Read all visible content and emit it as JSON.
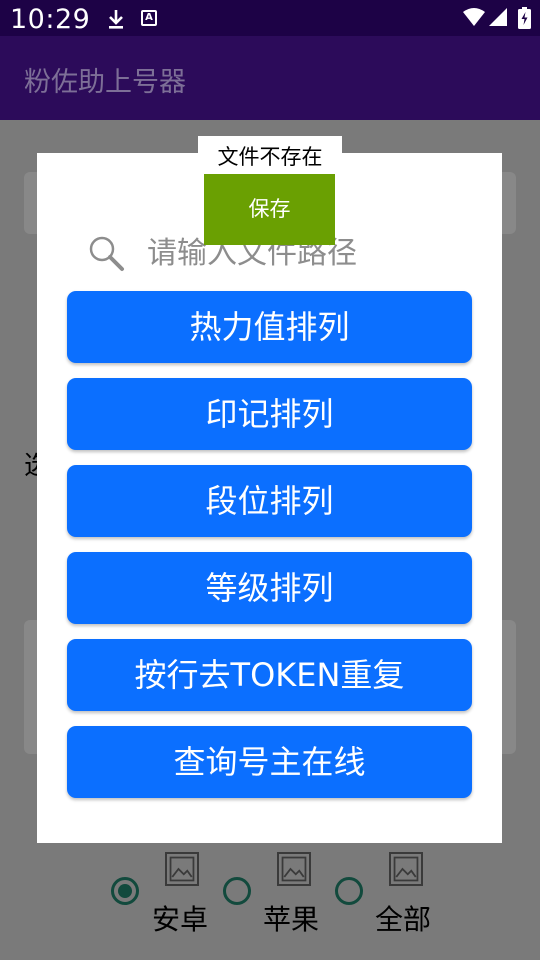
{
  "status_bar": {
    "time": "10:29",
    "download_icon": "download-icon",
    "a_icon_letter": "A",
    "wifi_icon": "wifi-icon",
    "signal_icon": "cell-signal-icon",
    "battery_icon": "battery-charging-icon"
  },
  "app_bar": {
    "title": "粉佐助上号器"
  },
  "background": {
    "partial_text": "选"
  },
  "dialog": {
    "search": {
      "placeholder": "请输入文件路径",
      "icon": "search-icon"
    },
    "buttons": [
      {
        "label": "热力值排列"
      },
      {
        "label": "印记排列"
      },
      {
        "label": "段位排列"
      },
      {
        "label": "等级排列"
      },
      {
        "label": "按行去TOKEN重复"
      },
      {
        "label": "查询号主在线"
      }
    ]
  },
  "toast": {
    "message": "文件不存在"
  },
  "save_button": {
    "label": "保存"
  },
  "platform_options": [
    {
      "label": "安卓",
      "checked": true,
      "icon": "image-placeholder-icon"
    },
    {
      "label": "苹果",
      "checked": false,
      "icon": "image-placeholder-icon"
    },
    {
      "label": "全部",
      "checked": false,
      "icon": "image-placeholder-icon"
    }
  ],
  "colors": {
    "status_bar": "#1d0246",
    "app_bar": "#2c0b5a",
    "primary_button": "#0b6fff",
    "save_button": "#6aa002",
    "radio": "#124a3d"
  }
}
